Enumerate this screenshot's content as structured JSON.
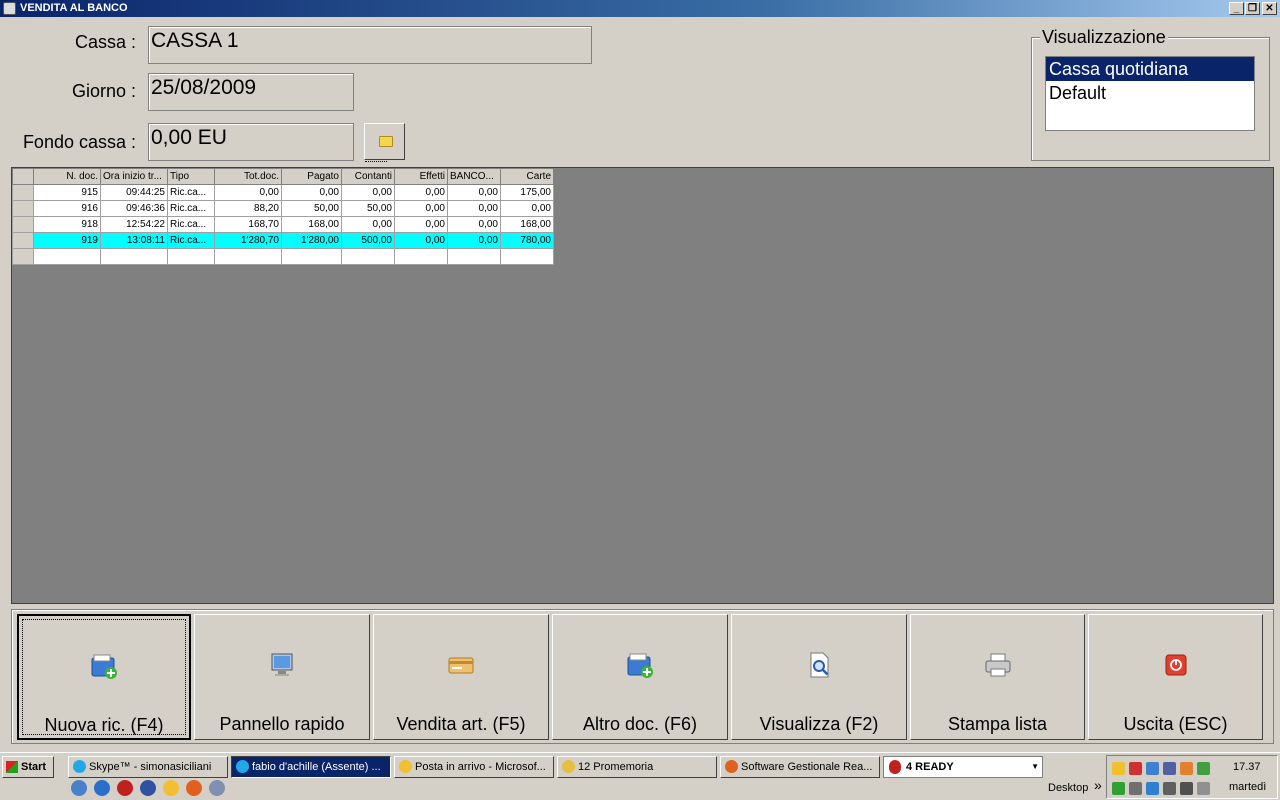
{
  "window": {
    "title": "VENDITA AL BANCO"
  },
  "form": {
    "cassa_label": "Cassa :",
    "cassa_value": "CASSA 1",
    "giorno_label": "Giorno :",
    "giorno_value": "25/08/2009",
    "fondo_label": "Fondo cassa :",
    "fondo_value": "0,00 EU"
  },
  "visualizzazione": {
    "legend": "Visualizzazione",
    "items": [
      "Cassa quotidiana",
      "Default"
    ],
    "selected": "Cassa quotidiana"
  },
  "grid": {
    "columns": [
      "N. doc.",
      "Ora inizio tr...",
      "Tipo",
      "Tot.doc.",
      "Pagato",
      "Contanti",
      "Effetti",
      "BANCO...",
      "Carte"
    ],
    "rows": [
      [
        "915",
        "09:44:25",
        "Ric.ca...",
        "0,00",
        "0,00",
        "0,00",
        "0,00",
        "0,00",
        "175,00"
      ],
      [
        "916",
        "09:46:36",
        "Ric.ca...",
        "88,20",
        "50,00",
        "50,00",
        "0,00",
        "0,00",
        "0,00"
      ],
      [
        "918",
        "12:54:22",
        "Ric.ca...",
        "168,70",
        "168,00",
        "0,00",
        "0,00",
        "0,00",
        "168,00"
      ],
      [
        "919",
        "13:08:11",
        "Ric.ca...",
        "1'280,70",
        "1'280,00",
        "500,00",
        "0,00",
        "0,00",
        "780,00"
      ]
    ],
    "highlighted_row": 3
  },
  "buttons": [
    {
      "label": "Nuova ric. (F4)",
      "icon": "new-receipt-icon"
    },
    {
      "label": "Pannello rapido",
      "icon": "monitor-icon"
    },
    {
      "label": "Vendita art. (F5)",
      "icon": "card-icon"
    },
    {
      "label": "Altro doc. (F6)",
      "icon": "new-doc-icon"
    },
    {
      "label": "Visualizza (F2)",
      "icon": "magnifier-icon"
    },
    {
      "label": "Stampa lista",
      "icon": "printer-icon"
    },
    {
      "label": "Uscita (ESC)",
      "icon": "power-icon"
    }
  ],
  "taskbar": {
    "start": "Start",
    "tasks": [
      "Skype™ - simonasiciliani",
      "fabio d'achille (Assente) ...",
      "Posta in arrivo - Microsof...",
      "12 Promemoria",
      "Software Gestionale Rea..."
    ],
    "ready": "4 READY",
    "desktop": "Desktop",
    "chevron": "»",
    "clock": "17.37",
    "day": "martedì"
  },
  "colors": {
    "title_bar": "#0a246a",
    "selected_row": "#00ffff",
    "grid_bg": "#808080"
  }
}
